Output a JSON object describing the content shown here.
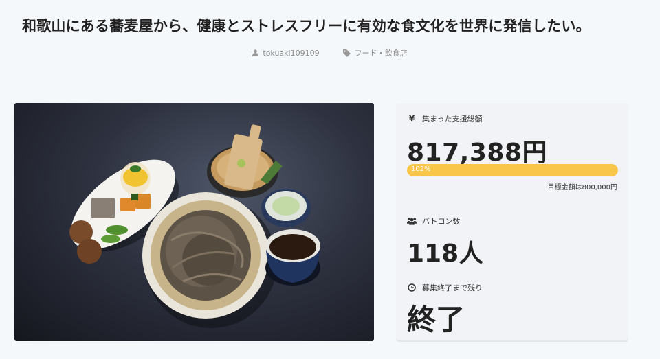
{
  "project": {
    "title": "和歌山にある蕎麦屋から、健康とストレスフリーに有効な食文化を世界に発信したい。",
    "author": "tokuaki109109",
    "category": "フード・飲食店"
  },
  "icons": {
    "author": "user-icon",
    "category": "tag-icon",
    "funds": "yen-icon",
    "batons": "users-icon",
    "remaining": "clock-icon"
  },
  "stats": {
    "funds_label": "集まった支援総額",
    "funds_amount": "817,388円",
    "progress_percent": 102,
    "progress_text": "102%",
    "goal_text": "目標金額は800,000円",
    "batons_label": "バトロン数",
    "batons_value": "118人",
    "remaining_label": "募集終了まで残り",
    "remaining_value": "終了"
  },
  "colors": {
    "progress": "#f9c64a",
    "background": "#f5f8fb"
  }
}
